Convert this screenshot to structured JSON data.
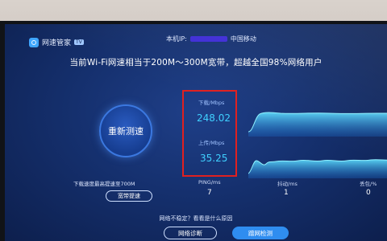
{
  "header": {
    "brand_name": "网速管家",
    "brand_badge": "TV",
    "ip_prefix": "本机IP:",
    "isp": "中国移动"
  },
  "headline": "当前Wi-Fi网速相当于200M～300M宽带，超越全国98%网络用户",
  "test_button": "重新测速",
  "download": {
    "label": "下载/Mbps",
    "value": "248.02"
  },
  "upload": {
    "label": "上传/Mbps",
    "value": "35.25"
  },
  "tip": "下载速度最高提速至700M",
  "bandwidth_button": "宽带提速",
  "stats": [
    {
      "label": "PING/ms",
      "value": "7"
    },
    {
      "label": "抖动/ms",
      "value": "1"
    },
    {
      "label": "丢包/%",
      "value": "0"
    }
  ],
  "unstable_text": "网络不稳定？看看是什么原因",
  "diag_button": "网络诊断",
  "neighbor_button": "蹭网检测",
  "colors": {
    "accent": "#3fd0ff",
    "highlight_box": "#e02020",
    "screen_bg": "#15306e",
    "primary_button": "#2f8df0"
  }
}
